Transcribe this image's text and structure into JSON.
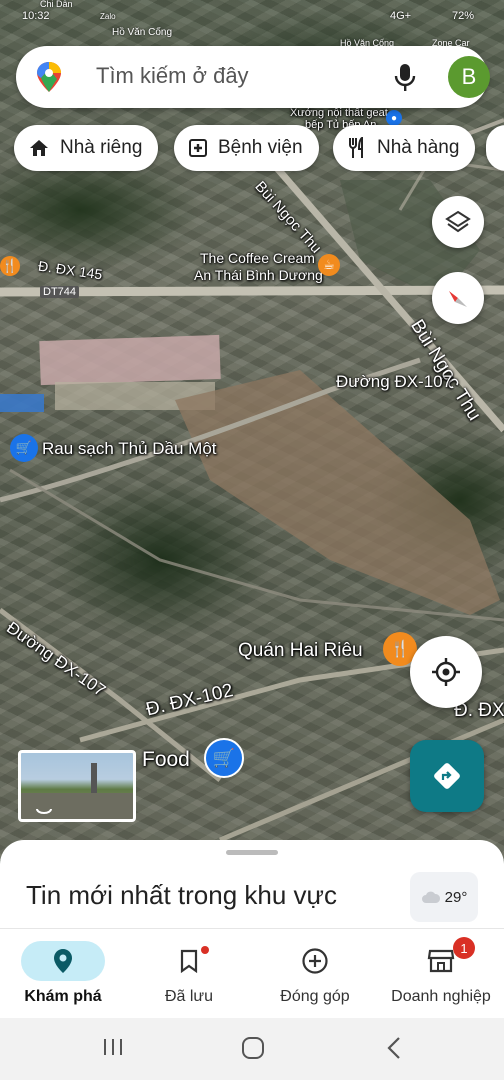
{
  "status_bar": {
    "time": "10:32",
    "carrier_label": "Zalo",
    "network": "4G+",
    "battery": "72%",
    "top_labels": [
      "Chi Dân",
      "Hồ Văn Cống",
      "Hồ Văn Cống",
      "Zone Car Detailing"
    ]
  },
  "search": {
    "placeholder": "Tìm kiếm ở đây",
    "avatar_letter": "B"
  },
  "chips": [
    {
      "label": "Nhà riêng",
      "icon": "home-icon"
    },
    {
      "label": "Bệnh viện",
      "icon": "hospital-icon"
    },
    {
      "label": "Nhà hàng",
      "icon": "restaurant-icon"
    }
  ],
  "map": {
    "labels": {
      "top_small_1": "Xưởng nội thất geat",
      "top_small_2": "bếp Tủ bếp An",
      "bui_ngoc_thu_top": "Bùi Ngọc Thu",
      "dx145": "Đ. ĐX 145",
      "dt744": "DT744",
      "coffee_1": "The Coffee Cream",
      "coffee_2": "An Thái Bình Dương",
      "bui_ngoc_thu_right": "Bùi Ngọc Thu",
      "duong_dx107_top": "Đường ĐX-107",
      "rau_sach": "Rau sạch Thủ Dầu Một",
      "duong_dx107_left": "Đường ĐX-107",
      "quan_hai_rieu": "Quán Hai Riêu",
      "dx102": "Đ. ĐX-102",
      "dx_right": "Đ. ĐX",
      "food": "Food"
    }
  },
  "sheet": {
    "title": "Tin mới nhất trong khu vực",
    "weather_temp": "29°"
  },
  "bottom_nav": [
    {
      "label": "Khám phá",
      "icon": "explore-pin-icon",
      "active": true
    },
    {
      "label": "Đã lưu",
      "icon": "bookmark-icon",
      "active": false
    },
    {
      "label": "Đóng góp",
      "icon": "add-circle-icon",
      "active": false
    },
    {
      "label": "Doanh nghiệp",
      "icon": "business-icon",
      "active": false,
      "badge": "1"
    }
  ],
  "colors": {
    "accent_blue": "#1a73e8",
    "directions_teal": "#0e7a86",
    "food_pin_orange": "#f28b1e",
    "avatar_green": "#5b9a2f"
  }
}
